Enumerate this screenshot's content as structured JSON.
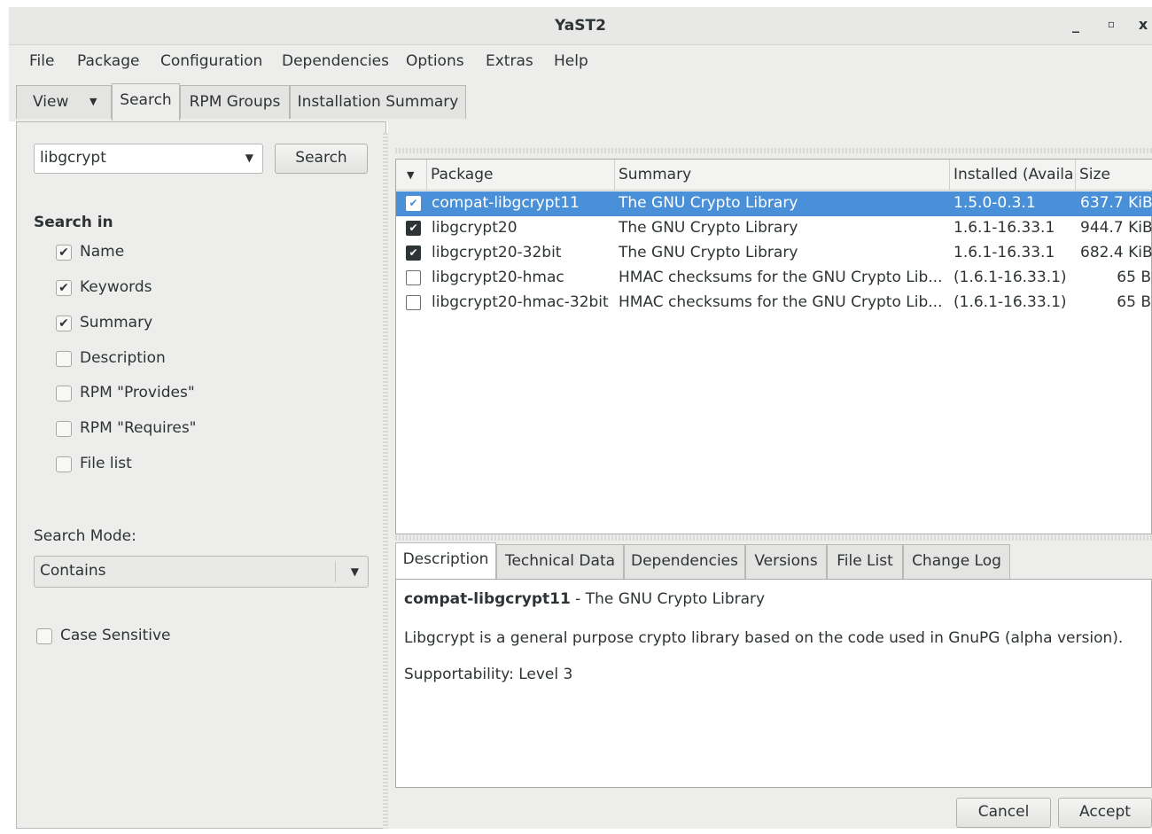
{
  "window": {
    "title": "YaST2",
    "minimize": "_",
    "maximize": "▫",
    "close": "x"
  },
  "menu": [
    "File",
    "Package",
    "Configuration",
    "Dependencies",
    "Options",
    "Extras",
    "Help"
  ],
  "tabs": {
    "view": "View",
    "search": "Search",
    "rpm_groups": "RPM Groups",
    "installation_summary": "Installation Summary"
  },
  "search": {
    "query": "libgcrypt",
    "button": "Search",
    "search_in_label": "Search in",
    "options": [
      {
        "label": "Name",
        "checked": true
      },
      {
        "label": "Keywords",
        "checked": true
      },
      {
        "label": "Summary",
        "checked": true
      },
      {
        "label": "Description",
        "checked": false
      },
      {
        "label": "RPM \"Provides\"",
        "checked": false
      },
      {
        "label": "RPM \"Requires\"",
        "checked": false
      },
      {
        "label": "File list",
        "checked": false
      }
    ],
    "mode_label": "Search Mode:",
    "mode_value": "Contains",
    "case_sensitive_label": "Case Sensitive"
  },
  "package_table": {
    "columns": [
      "Package",
      "Summary",
      "Installed (Availa",
      "Size"
    ],
    "rows": [
      {
        "package": "compat-libgcrypt11",
        "summary": "The GNU Crypto Library",
        "installed": "1.5.0-0.3.1",
        "size": "637.7 KiB",
        "checked": true,
        "selected": true
      },
      {
        "package": "libgcrypt20",
        "summary": "The GNU Crypto Library",
        "installed": "1.6.1-16.33.1",
        "size": "944.7 KiB",
        "checked": true,
        "selected": false
      },
      {
        "package": "libgcrypt20-32bit",
        "summary": "The GNU Crypto Library",
        "installed": "1.6.1-16.33.1",
        "size": "682.4 KiB",
        "checked": true,
        "selected": false
      },
      {
        "package": "libgcrypt20-hmac",
        "summary": "HMAC checksums for the GNU Crypto Lib...",
        "installed": "(1.6.1-16.33.1)",
        "size": "65 B",
        "checked": false,
        "selected": false
      },
      {
        "package": "libgcrypt20-hmac-32bit",
        "summary": "HMAC checksums for the GNU Crypto Lib...",
        "installed": "(1.6.1-16.33.1)",
        "size": "65 B",
        "checked": false,
        "selected": false
      }
    ]
  },
  "detail_tabs": [
    "Description",
    "Technical Data",
    "Dependencies",
    "Versions",
    "File List",
    "Change Log"
  ],
  "detail": {
    "package_name": "compat-libgcrypt11",
    "package_summary": " - The GNU Crypto Library",
    "description": "Libgcrypt is a general purpose crypto library based on the code used in GnuPG (alpha version).",
    "supportability": "Supportability: Level 3"
  },
  "buttons": {
    "cancel": "Cancel",
    "accept": "Accept"
  },
  "colors": {
    "selection": "#4a90d9",
    "window_bg": "#ededec"
  }
}
